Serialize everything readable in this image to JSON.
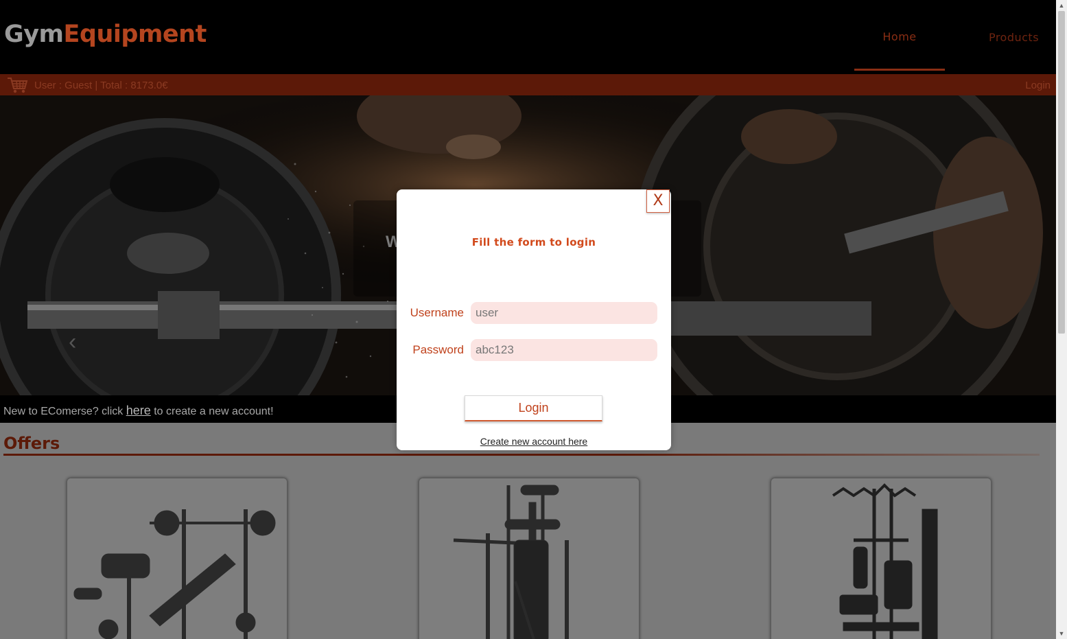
{
  "header": {
    "logo_part1": "Gym",
    "logo_part2": "Equipment",
    "nav": {
      "home": "Home",
      "products": "Products"
    }
  },
  "statusbar": {
    "cart_icon": "shopping-cart-icon",
    "text": "User : Guest | Total : 8173.0€",
    "login": "Login"
  },
  "hero": {
    "heading_partial": "W",
    "prev_icon": "chevron-left-icon"
  },
  "signup": {
    "prefix": "New to EComerse? click ",
    "link": "here",
    "suffix": " to create a new account!"
  },
  "offers": {
    "title": "Offers",
    "cards": [
      {
        "image": "weight-bench-image"
      },
      {
        "image": "power-tower-image"
      },
      {
        "image": "home-gym-image"
      }
    ]
  },
  "login_modal": {
    "close_label": "X",
    "title": "Fill the form to login",
    "username_label": "Username",
    "username_value": "user",
    "password_label": "Password",
    "password_value": "abc123",
    "submit_label": "Login",
    "create_account_link": "Create new account here"
  },
  "colors": {
    "accent": "#d24a1c",
    "header_bg": "#000000",
    "input_bg": "#fbe4e2"
  }
}
